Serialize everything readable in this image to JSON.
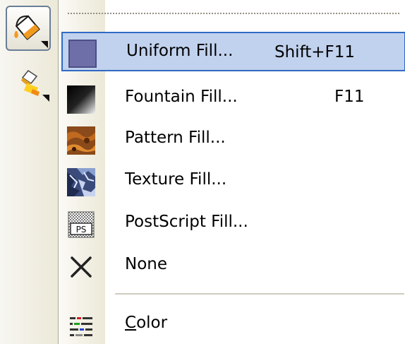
{
  "menu": {
    "items": [
      {
        "label": "Uniform Fill...",
        "shortcut": "Shift+F11",
        "icon": "uniform-fill-icon",
        "color": "#6e6fa8"
      },
      {
        "label": "Fountain Fill...",
        "shortcut": "F11",
        "icon": "fountain-fill-icon"
      },
      {
        "label": "Pattern Fill...",
        "shortcut": "",
        "icon": "pattern-fill-icon"
      },
      {
        "label": "Texture Fill...",
        "shortcut": "",
        "icon": "texture-fill-icon"
      },
      {
        "label": "PostScript Fill...",
        "shortcut": "",
        "icon": "postscript-fill-icon",
        "icon_text": "PS"
      },
      {
        "label": "None",
        "shortcut": "",
        "icon": "no-fill-icon"
      }
    ],
    "color_item": {
      "label_first": "C",
      "label_rest": "olor",
      "icon": "color-docker-icon"
    }
  },
  "toolbox": {
    "fill_tool_icon": "paint-bucket-icon",
    "interactive_fill_icon": "interactive-fill-icon"
  },
  "colors": {
    "highlight_bg": "#c1d2ee",
    "highlight_border": "#316ac5"
  }
}
